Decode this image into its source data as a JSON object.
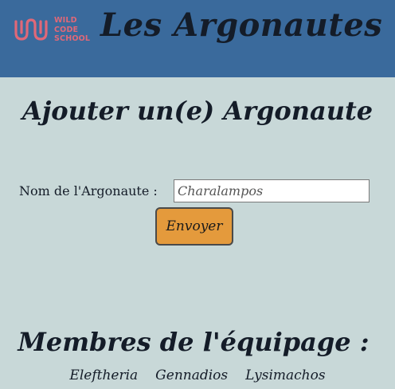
{
  "header": {
    "logo": {
      "lines": [
        "WILD",
        "CODE",
        "SCHOOL"
      ],
      "color": "#e06878"
    },
    "title": "Les Argonautes",
    "background": "#3a6a9c"
  },
  "form": {
    "heading": "Ajouter un(e) Argonaute",
    "name_label": "Nom de l'Argonaute :",
    "name_value": "Charalampos",
    "submit_label": "Envoyer",
    "submit_color": "#e49a3c"
  },
  "crew": {
    "heading": "Membres de l'équipage :",
    "members": [
      "Eleftheria",
      "Gennadios",
      "Lysimachos"
    ]
  },
  "page_background": "#c8d8d8"
}
